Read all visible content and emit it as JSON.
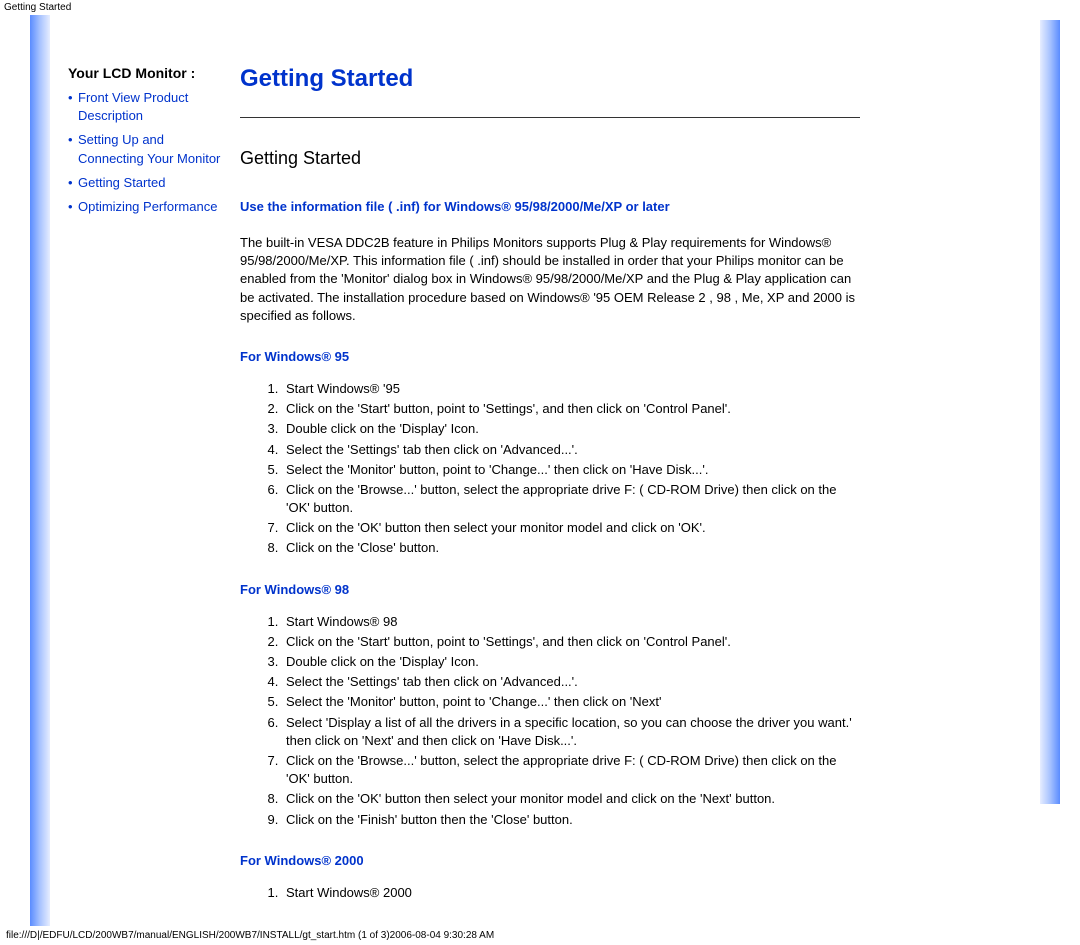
{
  "header": "Getting Started",
  "sidebar": {
    "title": "Your LCD Monitor :",
    "items": [
      "Front View Product Description",
      "Setting Up and Connecting Your Monitor",
      "Getting Started",
      "Optimizing Performance"
    ]
  },
  "main": {
    "title": "Getting Started",
    "subtitle": "Getting Started",
    "info_heading": "Use the information file ( .inf) for Windows® 95/98/2000/Me/XP or later",
    "body": "The built-in VESA DDC2B feature in Philips Monitors supports Plug & Play requirements for Windows® 95/98/2000/Me/XP. This information file ( .inf) should be installed in order that your Philips monitor can be enabled from the 'Monitor' dialog box in Windows® 95/98/2000/Me/XP and the Plug & Play application can be activated. The installation procedure based on Windows® '95 OEM Release 2 , 98 , Me, XP and 2000 is specified as follows.",
    "sections": [
      {
        "heading": "For Windows® 95",
        "steps": [
          "Start Windows® '95",
          "Click on the 'Start' button, point to 'Settings', and then click on 'Control Panel'.",
          "Double click on the 'Display' Icon.",
          "Select the 'Settings' tab then click on 'Advanced...'.",
          "Select the 'Monitor' button, point to 'Change...' then click on 'Have Disk...'.",
          "Click on the 'Browse...' button, select the appropriate drive F: ( CD-ROM Drive) then click on the 'OK' button.",
          "Click on the 'OK' button then select your monitor model and click on 'OK'.",
          "Click on the 'Close' button."
        ]
      },
      {
        "heading": "For Windows® 98",
        "steps": [
          "Start Windows® 98",
          "Click on the 'Start' button, point to 'Settings', and then click on 'Control Panel'.",
          "Double click on the 'Display' Icon.",
          "Select the 'Settings' tab then click on 'Advanced...'.",
          "Select the 'Monitor' button, point to 'Change...' then click on 'Next'",
          "Select 'Display a list of all the drivers in a specific location, so you can choose the driver you want.' then click on 'Next' and then click on 'Have Disk...'.",
          "Click on the 'Browse...' button, select the appropriate drive F: ( CD-ROM Drive) then click on the 'OK' button.",
          "Click on the 'OK' button then select your monitor model and click on the 'Next' button.",
          "Click on the 'Finish' button then the 'Close' button."
        ]
      },
      {
        "heading": "For Windows® 2000",
        "steps": [
          "Start Windows® 2000"
        ]
      }
    ]
  },
  "footer": "file:///D|/EDFU/LCD/200WB7/manual/ENGLISH/200WB7/INSTALL/gt_start.htm (1 of 3)2006-08-04 9:30:28 AM"
}
